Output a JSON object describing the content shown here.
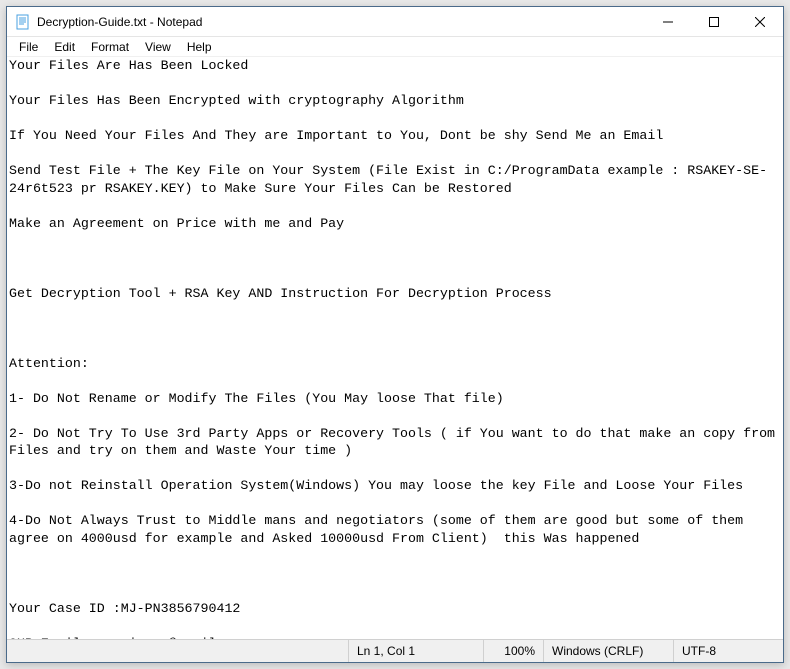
{
  "window": {
    "title": "Decryption-Guide.txt - Notepad"
  },
  "menu": {
    "file": "File",
    "edit": "Edit",
    "format": "Format",
    "view": "View",
    "help": "Help"
  },
  "document": {
    "content": "Your Files Are Has Been Locked\n\nYour Files Has Been Encrypted with cryptography Algorithm\n\nIf You Need Your Files And They are Important to You, Dont be shy Send Me an Email\n\nSend Test File + The Key File on Your System (File Exist in C:/ProgramData example : RSAKEY-SE-24r6t523 pr RSAKEY.KEY) to Make Sure Your Files Can be Restored\n\nMake an Agreement on Price with me and Pay\n\n\n\nGet Decryption Tool + RSA Key AND Instruction For Decryption Process\n\n\n\nAttention:\n\n1- Do Not Rename or Modify The Files (You May loose That file)\n\n2- Do Not Try To Use 3rd Party Apps or Recovery Tools ( if You want to do that make an copy from Files and try on them and Waste Your time )\n\n3-Do not Reinstall Operation System(Windows) You may loose the key File and Loose Your Files\n\n4-Do Not Always Trust to Middle mans and negotiators (some of them are good but some of them agree on 4000usd for example and Asked 10000usd From Client)  this Was happened\n\n\n\nYour Case ID :MJ-PN3856790412\n\nOUR Email    :wixawm@gmail.com"
  },
  "status": {
    "position": "Ln 1, Col 1",
    "zoom": "100%",
    "eol": "Windows (CRLF)",
    "encoding": "UTF-8"
  }
}
